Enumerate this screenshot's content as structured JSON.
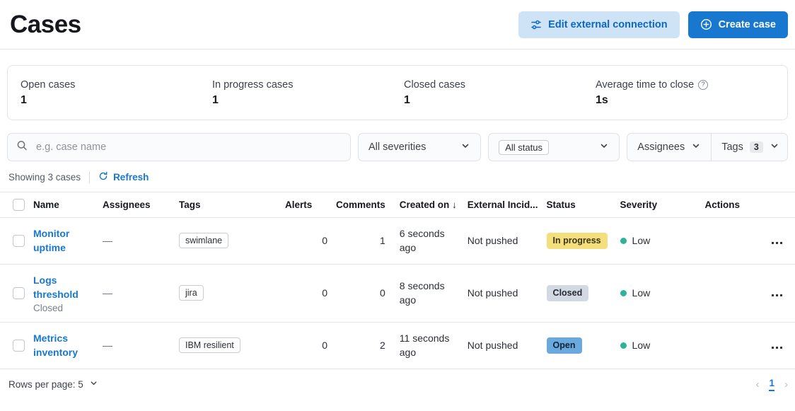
{
  "header": {
    "title": "Cases",
    "edit_connection_label": "Edit external connection",
    "create_case_label": "Create case"
  },
  "stats": [
    {
      "label": "Open cases",
      "value": "1",
      "has_help": false
    },
    {
      "label": "In progress cases",
      "value": "1",
      "has_help": false
    },
    {
      "label": "Closed cases",
      "value": "1",
      "has_help": false
    },
    {
      "label": "Average time to close",
      "value": "1s",
      "has_help": true
    }
  ],
  "filters": {
    "search_placeholder": "e.g. case name",
    "search_value": "",
    "severity_label": "All severities",
    "status_label": "All status",
    "assignees_label": "Assignees",
    "tags_label": "Tags",
    "tags_count": "3"
  },
  "toolbar": {
    "showing_text": "Showing 3 cases",
    "refresh_label": "Refresh"
  },
  "table": {
    "columns": [
      "Name",
      "Assignees",
      "Tags",
      "Alerts",
      "Comments",
      "Created on",
      "External Incid...",
      "Status",
      "Severity",
      "Actions"
    ],
    "sort_column": "Created on",
    "sort_direction": "↓",
    "rows": [
      {
        "name": "Monitor uptime",
        "sub": "",
        "assignees": "—",
        "tags": [
          "swimlane"
        ],
        "alerts": "0",
        "comments": "1",
        "created": "6 seconds ago",
        "external": "Not pushed",
        "status": "In progress",
        "status_bg": "#f5df7d",
        "status_fg": "#3d3413",
        "severity": "Low",
        "severity_color": "#2eb398"
      },
      {
        "name": "Logs threshold",
        "sub": "Closed",
        "assignees": "—",
        "tags": [
          "jira"
        ],
        "alerts": "0",
        "comments": "0",
        "created": "8 seconds ago",
        "external": "Not pushed",
        "status": "Closed",
        "status_bg": "#d3d9e3",
        "status_fg": "#272a30",
        "severity": "Low",
        "severity_color": "#2eb398"
      },
      {
        "name": "Metrics inventory",
        "sub": "",
        "assignees": "—",
        "tags": [
          "IBM resilient"
        ],
        "alerts": "0",
        "comments": "2",
        "created": "11 seconds ago",
        "external": "Not pushed",
        "status": "Open",
        "status_bg": "#6aa9dd",
        "status_fg": "#10233a",
        "severity": "Low",
        "severity_color": "#2eb398"
      }
    ]
  },
  "footer": {
    "rows_per_page_label": "Rows per page: 5",
    "prev_arrow": "‹",
    "current_page": "1",
    "next_arrow": "›"
  },
  "colors": {
    "primary": "#1878cf",
    "secondary_bg": "#cfe3f7",
    "link": "#1878cf"
  }
}
